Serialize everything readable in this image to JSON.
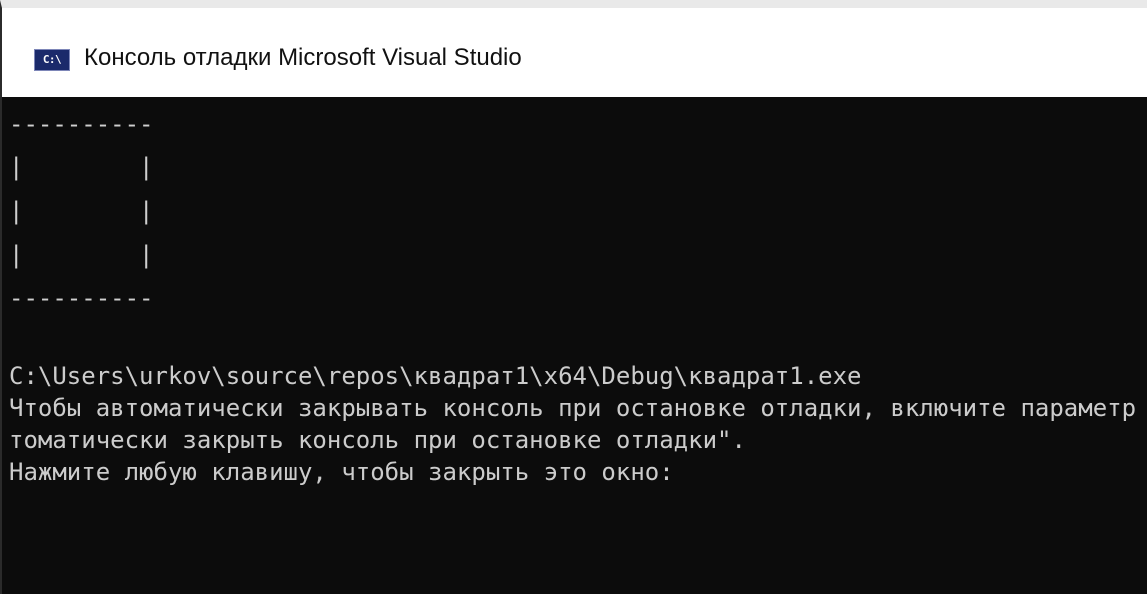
{
  "window": {
    "title": "Консоль отладки Microsoft Visual Studio",
    "icon_text": "C:\\",
    "icon": "console-app-icon"
  },
  "console": {
    "box_lines": [
      "----------",
      "|        |",
      "|        |",
      "|        |",
      "----------"
    ],
    "output_lines": [
      "C:\\Users\\urkov\\source\\repos\\квадрат1\\x64\\Debug\\квадрат1.exe",
      "Чтобы автоматически закрывать консоль при остановке отладки, включите параметр \"Сервис\" -> \"Параметры\" -> \"Отладка\" -> \"Ав",
      "томатически закрыть консоль при остановке отладки\".",
      "Нажмите любую клавишу, чтобы закрыть это окно:"
    ],
    "colors": {
      "background": "#0c0c0c",
      "text": "#cccccc"
    }
  }
}
